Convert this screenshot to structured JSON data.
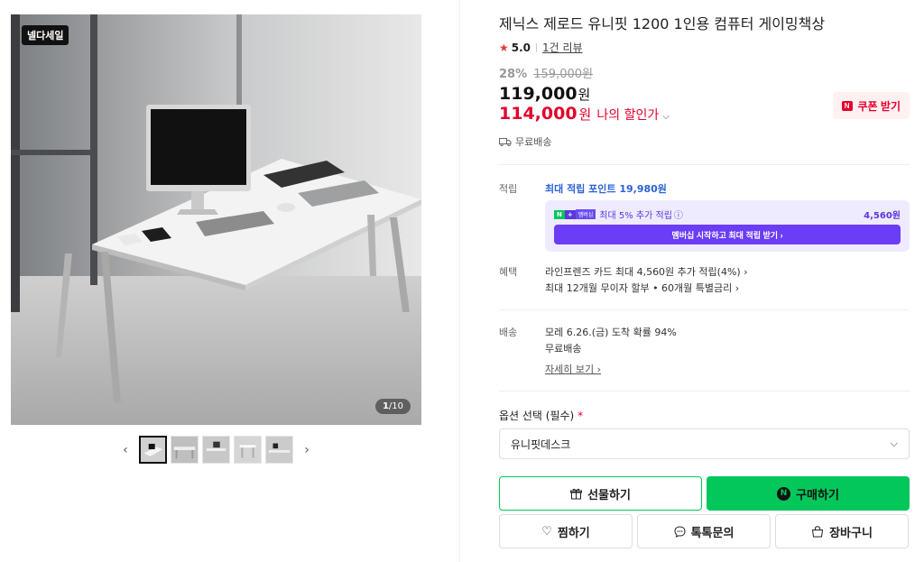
{
  "gallery": {
    "sale_badge": "넬다세일",
    "counter_current": "1",
    "counter_total": "/10",
    "thumbnails": 5,
    "prev_icon": "‹",
    "next_icon": "›"
  },
  "product": {
    "title": "제닉스 제로드 유니핏 1200 1인용 컴퓨터 게이밍책상",
    "rating": "5.0",
    "review_count": "1건 리뷰",
    "discount_pct": "28%",
    "original_price": "159,000원",
    "sale_price": "119,000",
    "sale_price_unit": "원",
    "my_price": "114,000",
    "my_price_unit": "원",
    "my_price_label": "나의 할인가",
    "coupon_label": "쿠폰 받기",
    "shipping_tag": "무료배송"
  },
  "points": {
    "label": "적립",
    "max_points": "최대 적립 포인트 19,980원",
    "membership_text": "최대 5% 추가 적립",
    "membership_amount": "4,560원",
    "membership_button": "멤버십 시작하고 최대 적립 받기 ›",
    "badge_n": "N",
    "badge_plus": "+",
    "badge_mem": "멤버십"
  },
  "benefits": {
    "label": "혜택",
    "line1": "라인프렌즈 카드 최대 4,560원 추가 적립(4%) ›",
    "line2": "최대 12개월 무이자 할부 • 60개월 특별금리 ›"
  },
  "delivery": {
    "label": "배송",
    "arrival": "모레 6.26.(금) 도착 확률 94%",
    "fee": "무료배송",
    "more": "자세히 보기 ›"
  },
  "options": {
    "label": "옵션 선택 (필수)",
    "required_mark": "*",
    "selected": "유니핏데스크"
  },
  "buttons": {
    "gift": "선물하기",
    "buy": "구매하기",
    "wish": "찜하기",
    "talk": "톡톡문의",
    "cart": "장바구니"
  },
  "colors": {
    "naver_green": "#03c75a",
    "discount_red": "#e5002b",
    "membership_purple": "#6b3df6",
    "link_blue": "#2a63d6"
  }
}
